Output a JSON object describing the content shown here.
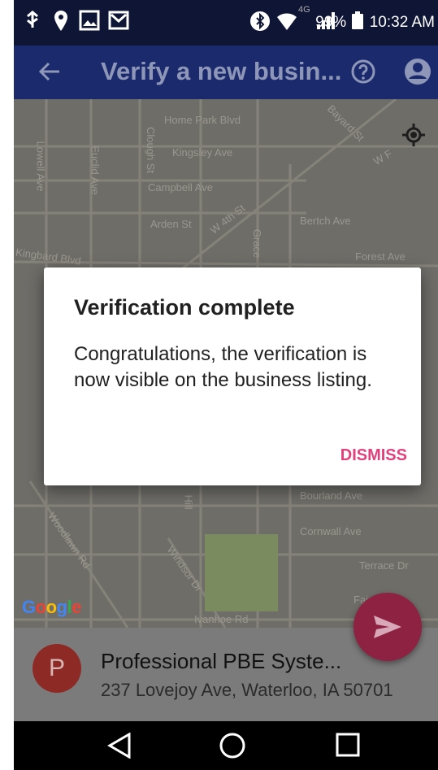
{
  "status_bar": {
    "battery": "99%",
    "time": "10:32 AM",
    "left_icons": [
      "usb-icon",
      "location-icon",
      "image-icon",
      "mail-icon"
    ],
    "right_icons": [
      "bluetooth-icon",
      "wifi-icon",
      "signal-icon",
      "battery-icon"
    ],
    "network_label": "4G"
  },
  "app_bar": {
    "title": "Verify a new busin...",
    "icons": [
      "back-arrow-icon",
      "help-icon",
      "account-icon"
    ]
  },
  "map": {
    "roads": [
      "Home Park Blvd",
      "Bayard St",
      "Kingsley Ave",
      "Clough St",
      "Campbell Ave",
      "Lowell Ave",
      "Euclid Ave",
      "W 4th St",
      "Arden St",
      "Bertch Ave",
      "Kingbard Blvd",
      "Forest Ave",
      "Grace",
      "Bourland Ave",
      "Woodlawn Rd",
      "Hill",
      "Cornwall Ave",
      "Windsor Dr",
      "Terrace Dr",
      "Fairview",
      "Ivanhoe Rd",
      "W F"
    ],
    "logo": "Google",
    "logo_colors": [
      "#4285f4",
      "#ea4335",
      "#fbbc05",
      "#4285f4",
      "#34a853",
      "#ea4335"
    ],
    "icons": [
      "my-location-icon"
    ]
  },
  "dialog": {
    "title": "Verification complete",
    "body": "Congratulations, the verification is now visible on the business listing.",
    "dismiss_label": "DISMISS",
    "accent_color": "#e2407a"
  },
  "place_card": {
    "avatar_letter": "P",
    "name": "Professional PBE Syste...",
    "address": "237 Lovejoy Ave, Waterloo, IA 50701"
  },
  "fab": {
    "icon": "send-icon",
    "color": "#8e2243"
  },
  "nav_bar": {
    "icons": [
      "back-triangle-icon",
      "home-circle-icon",
      "recents-square-icon"
    ]
  }
}
